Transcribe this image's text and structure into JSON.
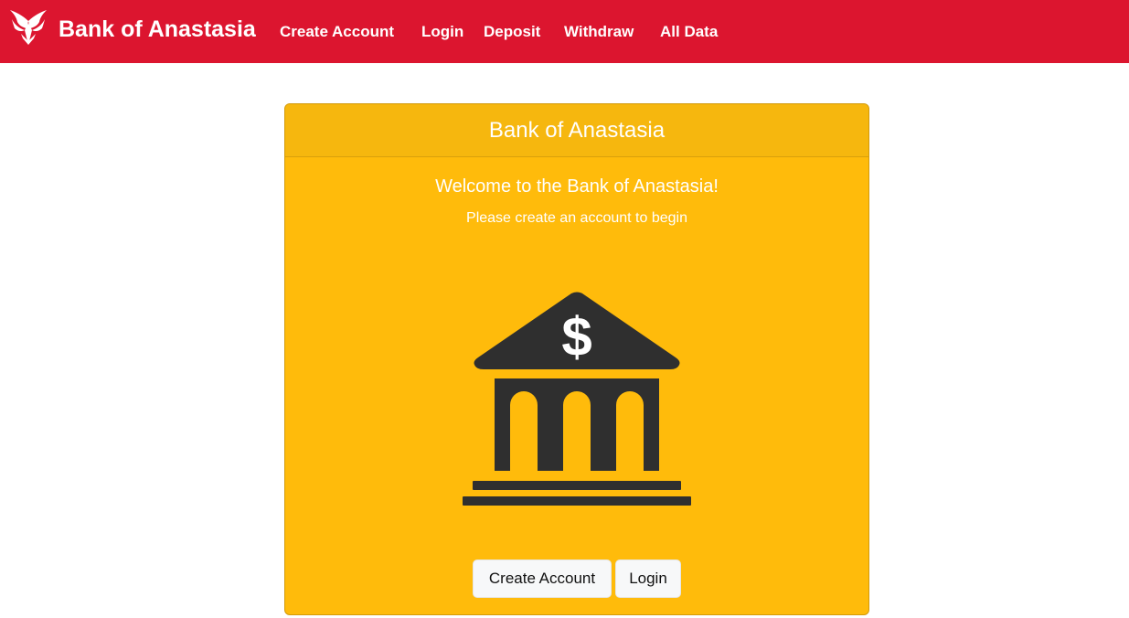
{
  "navbar": {
    "brand": "Bank of Anastasia",
    "logo_icon": "phoenix-logo-icon",
    "background_color": "#dc152f",
    "links": [
      {
        "label": "Create Account"
      },
      {
        "label": "Login"
      },
      {
        "label": "Deposit"
      },
      {
        "label": "Withdraw"
      },
      {
        "label": "All Data"
      }
    ]
  },
  "card": {
    "header": "Bank of Anastasia",
    "title": "Welcome to the Bank of Anastasia!",
    "text": "Please create an account to begin",
    "illustration_icon": "bank-building-dollar-icon",
    "background_color": "#ffbb0b",
    "buttons": {
      "create_account": "Create Account",
      "login": "Login"
    }
  }
}
